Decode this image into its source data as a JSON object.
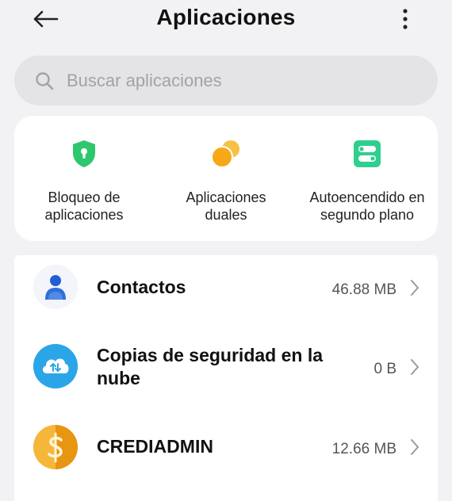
{
  "header": {
    "title": "Aplicaciones",
    "back_icon": "arrow-left-icon",
    "more_icon": "more-vertical-icon"
  },
  "search": {
    "placeholder": "Buscar aplicaciones",
    "value": "",
    "icon": "search-icon"
  },
  "shortcuts": [
    {
      "line1": "Bloqueo de",
      "line2": "aplicaciones",
      "icon": "shield-lock-icon",
      "color": "#2dc86e"
    },
    {
      "line1": "Aplicaciones",
      "line2": "duales",
      "icon": "dual-circles-icon",
      "color": "#f6a817"
    },
    {
      "line1": "Autoencendido en",
      "line2": "segundo plano",
      "icon": "toggle-icon",
      "color": "#2fcf8e"
    }
  ],
  "apps": [
    {
      "name_line1": "Contactos",
      "name_line2": "",
      "size": "46.88 MB",
      "icon": "contacts-icon",
      "color": "#2f6ed9"
    },
    {
      "name_line1": "Copias de seguridad en la",
      "name_line2": "nube",
      "size": "0 B",
      "icon": "cloud-backup-icon",
      "color": "#2aa6e8"
    },
    {
      "name_line1": "CREDIADMIN",
      "name_line2": "",
      "size": "12.66 MB",
      "icon": "dollar-coin-icon",
      "color": "#f2a020"
    }
  ]
}
